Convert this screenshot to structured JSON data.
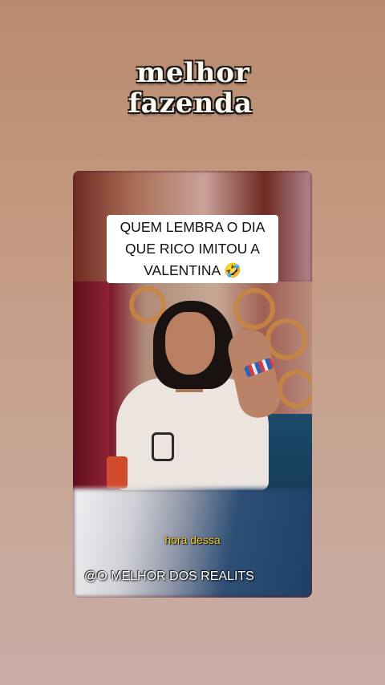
{
  "header": {
    "title_line1": "melhor",
    "title_line2": "fazenda"
  },
  "video": {
    "caption": "QUEM LEMBRA O DIA QUE RICO IMITOU A VALENTINA 🤣",
    "subtitle": "hora dessa",
    "watermark": "@O MELHOR DOS REALITS"
  },
  "colors": {
    "background": "#c49c84",
    "subtitle": "#f6d03a",
    "caption_bg": "#ffffff"
  }
}
